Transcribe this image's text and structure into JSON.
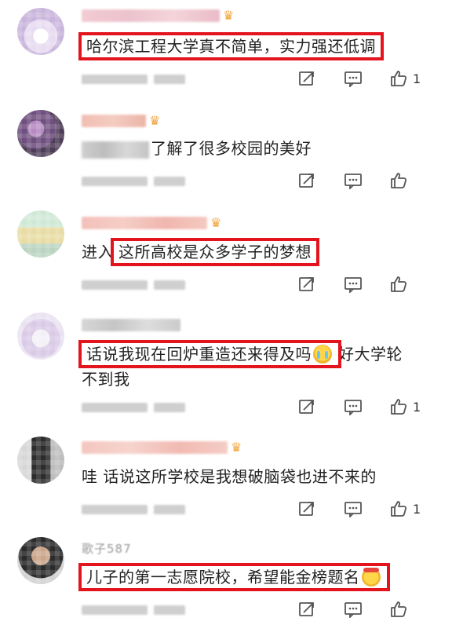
{
  "comments": [
    {
      "username": "",
      "text": "哈尔滨工程大学真不简单，实力强还低调",
      "text_prefix": "",
      "text_after": "",
      "time": "",
      "location": "",
      "likes": "1",
      "colors": {
        "name": "#f1c7cf",
        "avatar": "#e3d1f0"
      }
    },
    {
      "username": "",
      "text": "了解了很多校园的美好",
      "text_prefix": "",
      "text_after": "",
      "time": "",
      "location": "",
      "likes": "",
      "colors": {
        "name": "#f0b6a9",
        "avatar": "#7a5d88"
      }
    },
    {
      "username": "",
      "text": "这所高校是众多学子的梦想",
      "text_prefix": "进入",
      "text_after": "",
      "time": "",
      "location": "",
      "likes": "",
      "colors": {
        "name": "#f1b9b2",
        "avatar": "#b7d9c0"
      }
    },
    {
      "username": "",
      "text": "话说我现在回炉重造还来得及吗",
      "text_prefix": "",
      "text_after": "好大学轮",
      "text_line2": "不到我",
      "time": "",
      "location": "",
      "likes": "1",
      "colors": {
        "name": "#d8d8d8",
        "avatar": "#d8c9e6"
      }
    },
    {
      "username": "",
      "text": "哇 话说这所学校是我想破脑袋也进不来的",
      "text_prefix": "",
      "text_after": "",
      "time": "",
      "location": "",
      "likes": "1",
      "colors": {
        "name": "#f2bdb6",
        "avatar": "#3a3a3a"
      }
    },
    {
      "username": "歌子587",
      "text": "儿子的第一志愿院校，希望能金榜题名",
      "text_prefix": "",
      "text_after": "",
      "time": "",
      "location": "",
      "likes": "",
      "colors": {
        "name": "#8f8f8f",
        "avatar": "#2f2f2f"
      }
    }
  ],
  "icons": {
    "share": "share-icon",
    "comment": "comment-icon",
    "like": "thumbs-up-icon",
    "crown": "crown-badge-icon",
    "emoji_cry": "crying-face-emoji",
    "emoji_cheer": "cheering-face-emoji"
  },
  "accent": {
    "highlight_red": "#e3141d"
  }
}
